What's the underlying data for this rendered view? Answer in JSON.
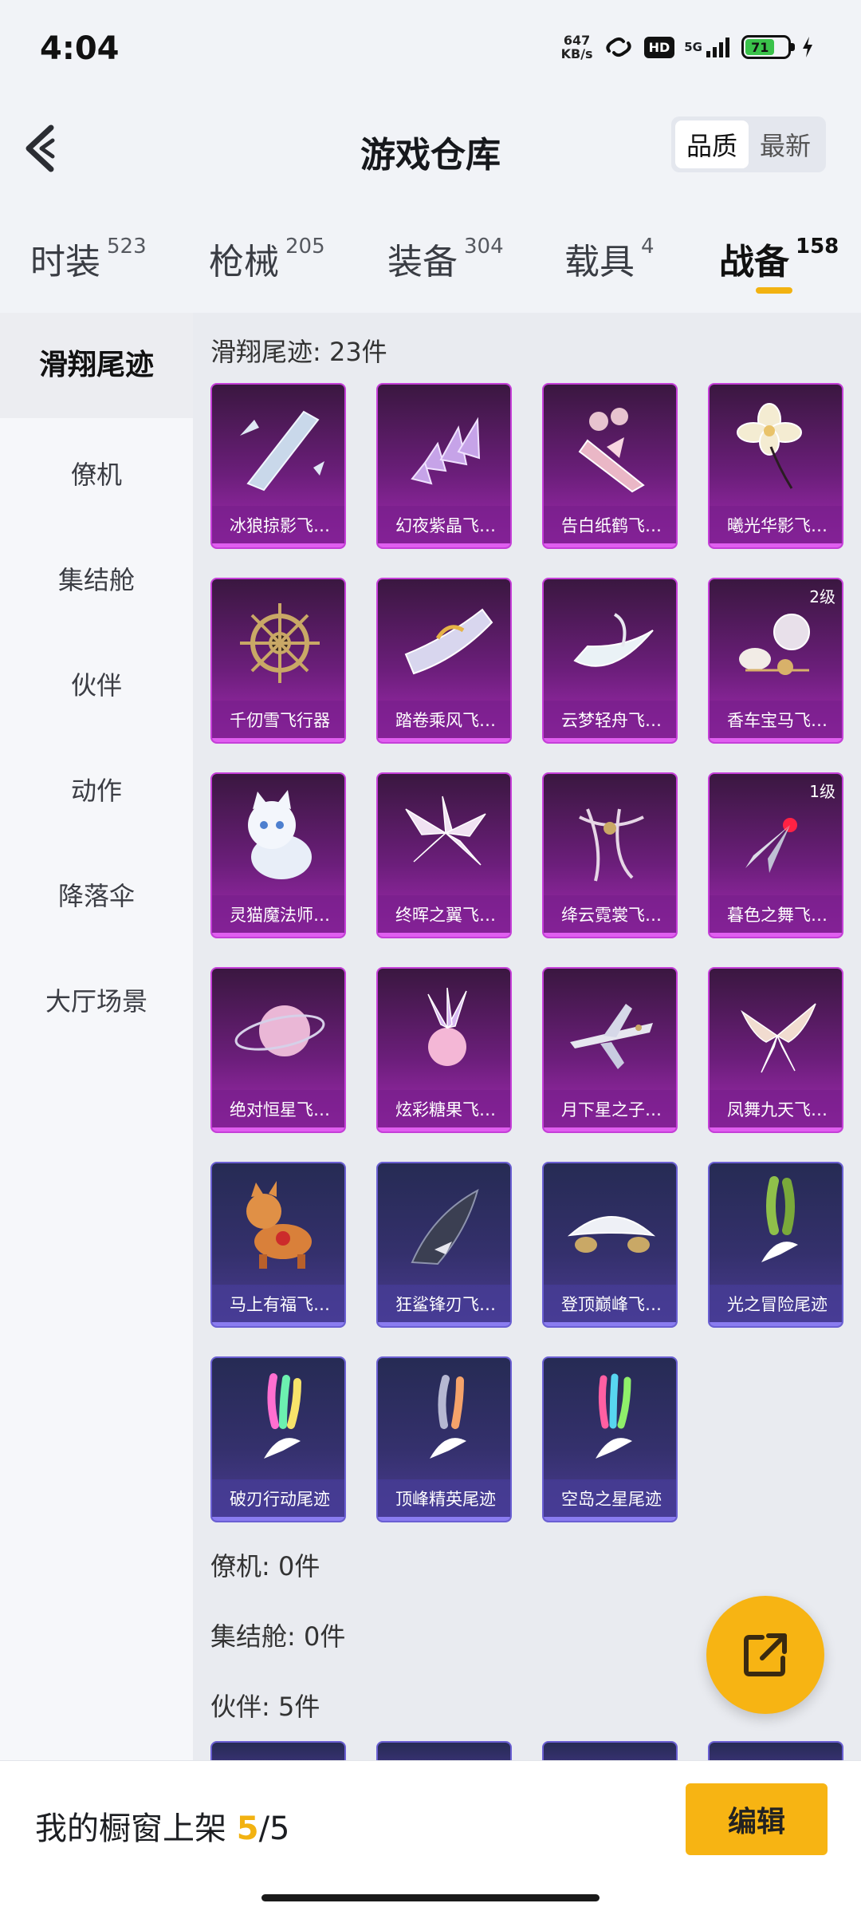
{
  "status": {
    "time": "4:04",
    "net_speed_value": "647",
    "net_speed_unit": "KB/s",
    "hd": "HD",
    "signal": "5G",
    "battery": "71"
  },
  "header": {
    "title": "游戏仓库",
    "sort_options": [
      "品质",
      "最新"
    ],
    "sort_active": "品质"
  },
  "tabs": [
    {
      "label": "时装",
      "count": "523"
    },
    {
      "label": "枪械",
      "count": "205"
    },
    {
      "label": "装备",
      "count": "304"
    },
    {
      "label": "载具",
      "count": "4"
    },
    {
      "label": "战备",
      "count": "158"
    }
  ],
  "active_tab": "战备",
  "sidebar": {
    "items": [
      "滑翔尾迹",
      "僚机",
      "集结舱",
      "伙伴",
      "动作",
      "降落伞",
      "大厅场景"
    ],
    "active": "滑翔尾迹"
  },
  "sections": {
    "glide": "滑翔尾迹: 23件",
    "wingman": "僚机: 0件",
    "capsule": "集结舱: 0件",
    "partner": "伙伴: 5件"
  },
  "items": [
    {
      "name": "冰狼掠影飞…",
      "rarity": "purple",
      "icon": "ice-shard-icon"
    },
    {
      "name": "幻夜紫晶飞…",
      "rarity": "purple",
      "icon": "crystal-cluster-icon"
    },
    {
      "name": "告白纸鹤飞…",
      "rarity": "purple",
      "icon": "paper-crane-icon"
    },
    {
      "name": "曦光华影飞…",
      "rarity": "purple",
      "icon": "flower-icon"
    },
    {
      "name": "千仞雪飞行器",
      "rarity": "purple",
      "icon": "ship-wheel-icon"
    },
    {
      "name": "踏卷乘风飞…",
      "rarity": "purple",
      "icon": "scroll-glider-icon"
    },
    {
      "name": "云梦轻舟飞…",
      "rarity": "purple",
      "icon": "cloud-boat-icon"
    },
    {
      "name": "香车宝马飞…",
      "rarity": "purple",
      "icon": "carriage-icon",
      "level": "2级"
    },
    {
      "name": "灵猫魔法师…",
      "rarity": "purple",
      "icon": "white-cat-icon"
    },
    {
      "name": "终晖之翼飞…",
      "rarity": "purple",
      "icon": "wings-icon"
    },
    {
      "name": "绛云霓裳飞…",
      "rarity": "purple",
      "icon": "ribbon-icon"
    },
    {
      "name": "暮色之舞飞…",
      "rarity": "purple",
      "icon": "blade-glider-icon",
      "level": "1级"
    },
    {
      "name": "绝对恒星飞…",
      "rarity": "purple",
      "icon": "planet-icon"
    },
    {
      "name": "炫彩糖果飞…",
      "rarity": "purple",
      "icon": "candy-icon"
    },
    {
      "name": "月下星之子…",
      "rarity": "purple",
      "icon": "jet-plane-icon"
    },
    {
      "name": "凤舞九天飞…",
      "rarity": "purple",
      "icon": "phoenix-icon"
    },
    {
      "name": "马上有福飞…",
      "rarity": "blue",
      "icon": "toy-horse-icon"
    },
    {
      "name": "狂鲨锋刃飞…",
      "rarity": "blue",
      "icon": "shark-icon"
    },
    {
      "name": "登顶巅峰飞…",
      "rarity": "blue",
      "icon": "hover-craft-icon"
    },
    {
      "name": "光之冒险尾迹",
      "rarity": "blue",
      "icon": "green-smoke-trail-icon"
    },
    {
      "name": "破刃行动尾迹",
      "rarity": "blue",
      "icon": "rainbow-smoke-trail-icon"
    },
    {
      "name": "顶峰精英尾迹",
      "rarity": "blue",
      "icon": "fire-smoke-trail-icon"
    },
    {
      "name": "空岛之星尾迹",
      "rarity": "blue",
      "icon": "multicolor-smoke-trail-icon"
    }
  ],
  "footer": {
    "label": "我的橱窗上架",
    "count_current": "5",
    "count_separator": "/",
    "count_total": "5",
    "edit": "编辑"
  },
  "colors": {
    "accent": "#f7b413",
    "purple_card": "#a42bb4",
    "blue_card": "#4b3c93"
  }
}
